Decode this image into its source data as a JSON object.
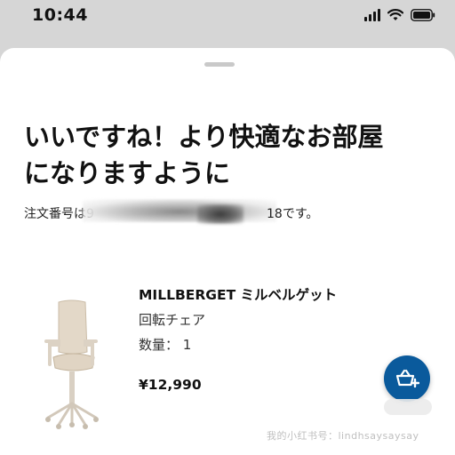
{
  "status_bar": {
    "time": "10:44"
  },
  "headline": {
    "line1": "いいですね！より快適なお部屋",
    "line2": "になりますように"
  },
  "order": {
    "prefix": "注文番号は9",
    "suffix": "18です。"
  },
  "product": {
    "name": "MILLBERGET ミルベルゲット",
    "type": "回転チェア",
    "quantity": "数量： 1",
    "price": "¥12,990"
  },
  "icons": {
    "fab": "basket-add-icon",
    "product": "swivel-chair-image"
  },
  "colors": {
    "fab": "#0a5a9c",
    "backdrop": "#d6d6d6",
    "sheet": "#ffffff"
  },
  "watermark": "我的小红书号：lindhsaysaysay"
}
